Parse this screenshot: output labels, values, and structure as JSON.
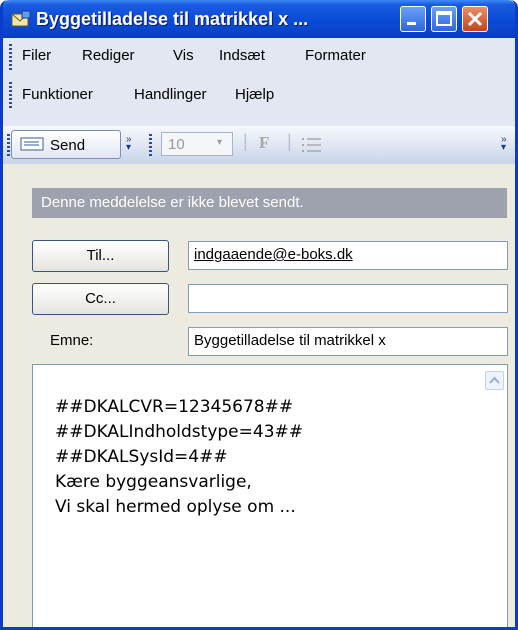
{
  "window": {
    "title": "Byggetilladelse til matrikkel x ...",
    "icon": "envelope-icon"
  },
  "menubar": {
    "items": [
      "Filer",
      "Rediger",
      "Vis",
      "Indsæt",
      "Formater",
      "Funktioner",
      "Handlinger",
      "Hjælp"
    ]
  },
  "toolbar": {
    "send_label": "Send",
    "font_size": "10",
    "bold_label": "F"
  },
  "infobar": {
    "text": "Denne meddelelse er ikke blevet sendt."
  },
  "fields": {
    "to_button": "Til...",
    "to_value": "indgaaende@e-boks.dk",
    "cc_button": "Cc...",
    "cc_value": "",
    "subject_label": "Emne:",
    "subject_value": "Byggetilladelse til matrikkel x"
  },
  "body": {
    "lines": [
      "##DKALCVR=12345678##",
      "##DKALIndholdstype=43##",
      "##DKALSysId=4##",
      "Kære byggeansvarlige,",
      "Vi skal hermed oplyse om ..."
    ]
  },
  "colors": {
    "titlebar": "#0B4DD8",
    "infobar": "#9EA2AE",
    "close_button": "#C9411A"
  }
}
